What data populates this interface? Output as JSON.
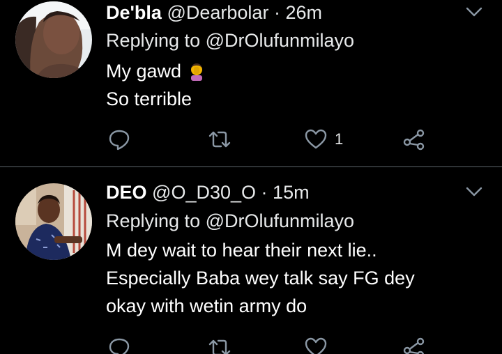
{
  "tweets": [
    {
      "display_name": "De'bla",
      "handle": "@Dearbolar",
      "separator": "·",
      "time": "26m",
      "replying_to": "Replying to @DrOlufunmilayo",
      "lines": [
        "My gawd",
        "So terrible"
      ],
      "emoji": "person-facepalming-icon",
      "like_count": "1"
    },
    {
      "display_name": "DEO",
      "handle": "@O_D30_O",
      "separator": "·",
      "time": "15m",
      "replying_to": "Replying to @DrOlufunmilayo",
      "lines": [
        "M dey wait to hear their next lie..",
        "Especially Baba wey talk say FG dey",
        "okay with wetin army do"
      ],
      "like_count": ""
    }
  ],
  "icons": [
    "chevron-down-icon",
    "reply-icon",
    "retweet-icon",
    "like-icon",
    "share-icon"
  ],
  "colors": {
    "background": "#000000",
    "icon": "#8b98a5",
    "divider": "#2f3336"
  }
}
